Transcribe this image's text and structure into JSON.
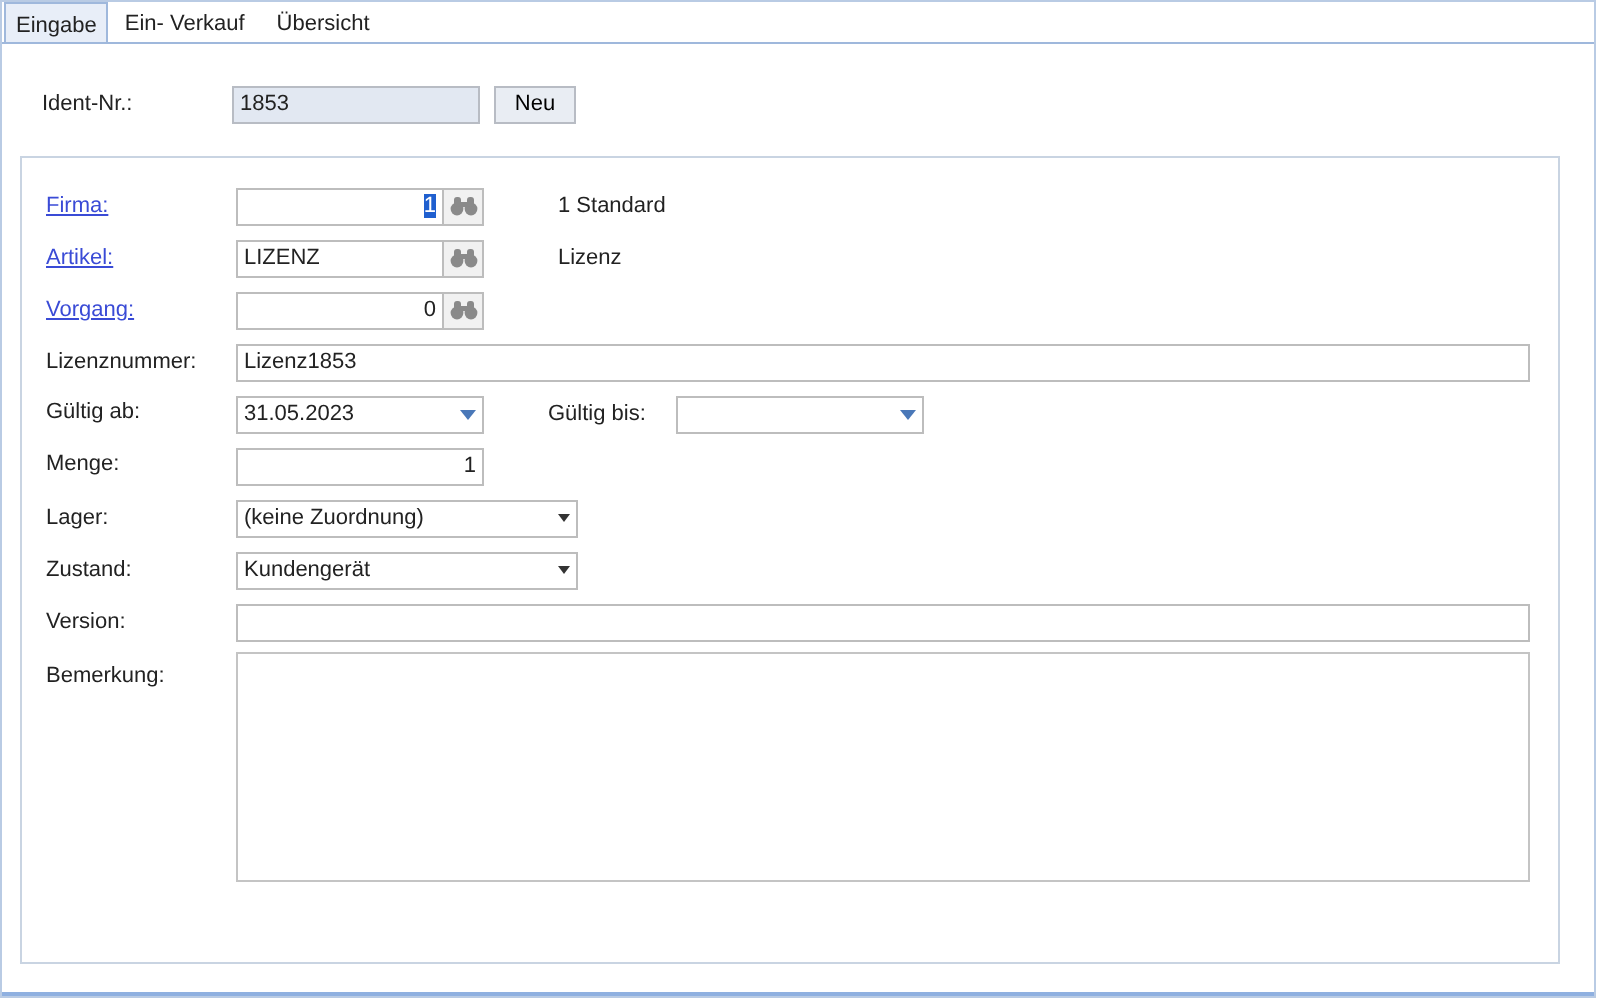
{
  "tabs": [
    {
      "label": "Eingabe",
      "selected": true
    },
    {
      "label": "Ein- Verkauf",
      "selected": false
    },
    {
      "label": "Übersicht",
      "selected": false
    }
  ],
  "ident": {
    "label": "Ident-Nr.:",
    "value": "1853",
    "button": "Neu"
  },
  "lookups": [
    {
      "label": "Firma:",
      "value": "1",
      "text_selected": true,
      "kind": "number",
      "info": "1 Standard"
    },
    {
      "label": "Artikel:",
      "value": "LIZENZ",
      "text_selected": false,
      "kind": "text",
      "info": "Lizenz"
    },
    {
      "label": "Vorgang:",
      "value": "0",
      "text_selected": false,
      "kind": "number"
    }
  ],
  "fields": [
    {
      "kind": "text",
      "label": "Lizenznummer:",
      "value": "Lizenz1853"
    },
    {
      "kind": "date",
      "label": "Gültig ab:",
      "value": "31.05.2023",
      "label2": "Gültig bis:"
    },
    {
      "kind": "number",
      "label": "Menge:",
      "value": "1"
    },
    {
      "kind": "combo",
      "label": "Lager:",
      "value": "(keine Zuordnung)"
    },
    {
      "kind": "combo",
      "label": "Zustand:",
      "value": "Kundengerät"
    },
    {
      "kind": "text",
      "label": "Version:"
    },
    {
      "kind": "memo",
      "label": "Bemerkung:"
    }
  ]
}
